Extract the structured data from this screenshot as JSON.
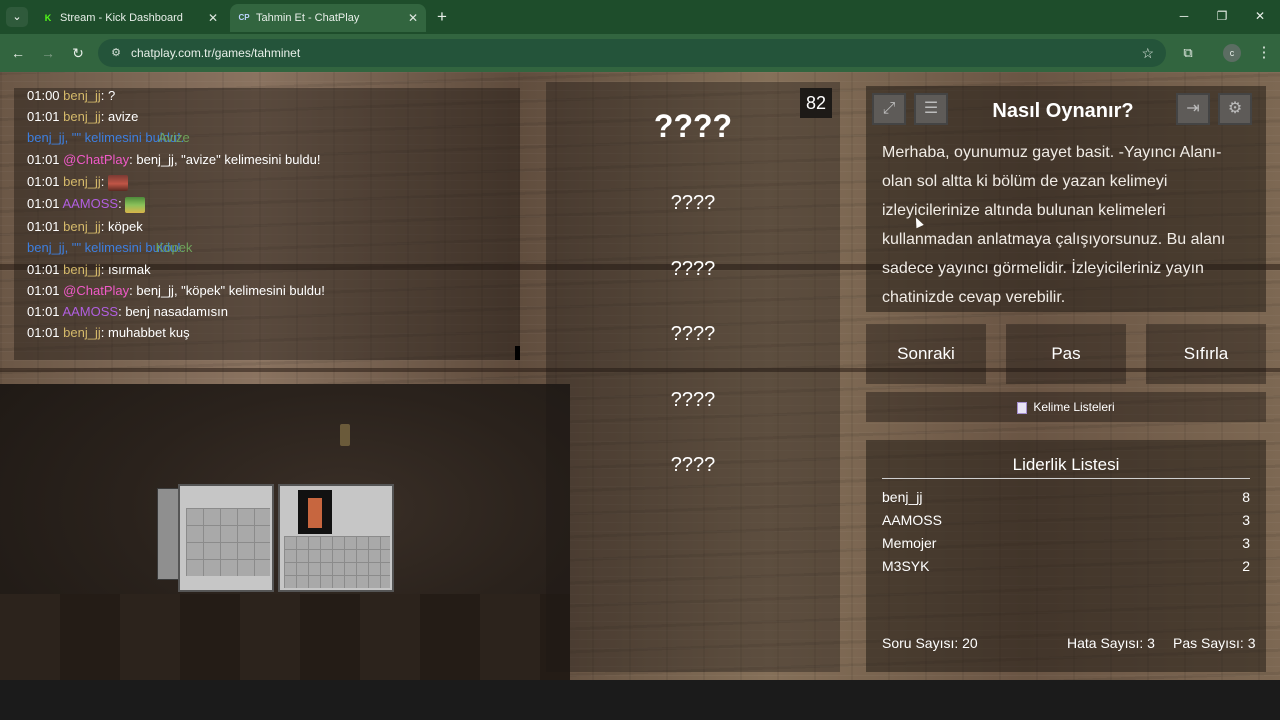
{
  "browser": {
    "tabs": [
      {
        "title": "Stream - Kick Dashboard",
        "favicon": "kick-favicon",
        "active": false
      },
      {
        "title": "Tahmin Et - ChatPlay",
        "favicon": "chatplay-favicon",
        "active": true
      }
    ],
    "url": "chatplay.com.tr/games/tahminet"
  },
  "chat": [
    {
      "time": "01:00",
      "user": "benj_jj",
      "text": "?"
    },
    {
      "time": "01:01",
      "user": "benj_jj",
      "text": "avize"
    },
    {
      "pre": "benj_jj, \"",
      "word": "Avize",
      "post": "\" kelimesini buldu!."
    },
    {
      "time": "01:01",
      "user": "@ChatPlay",
      "text": "benj_jj, \"avize\" kelimesini buldu!"
    },
    {
      "time": "01:01",
      "user": "benj_jj",
      "text": ""
    },
    {
      "time": "01:01",
      "user": "AAMOSS",
      "text": ""
    },
    {
      "time": "01:01",
      "user": "benj_jj",
      "text": "köpek"
    },
    {
      "pre": "benj_jj, \"",
      "word": "Köpek",
      "post": "\" kelimesini buldu!."
    },
    {
      "time": "01:01",
      "user": "benj_jj",
      "text": "ısırmak"
    },
    {
      "time": "01:01",
      "user": "@ChatPlay",
      "text": "benj_jj, \"köpek\" kelimesini buldu!"
    },
    {
      "time": "01:01",
      "user": "AAMOSS",
      "text": "benj nasadamısın"
    },
    {
      "time": "01:01",
      "user": "benj_jj",
      "text": "muhabbet kuş"
    }
  ],
  "game": {
    "counter": "82",
    "main_word": "????",
    "words": [
      "????",
      "????",
      "????",
      "????",
      "????"
    ]
  },
  "info": {
    "title": "Nasıl Oynanır?",
    "text": "Merhaba, oyunumuz gayet basit. -Yayıncı Alanı- olan sol altta ki bölüm de yazan kelimeyi izleyicilerinize altında bulunan kelimeleri kullanmadan anlatmaya çalışıyorsunuz. Bu alanı sadece yayıncı görmelidir. İzleyicileriniz yayın chatinizde cevap verebilir."
  },
  "controls": {
    "next": "Sonraki",
    "pass": "Pas",
    "reset": "Sıfırla",
    "word_lists": "Kelime Listeleri"
  },
  "leaderboard": {
    "title": "Liderlik Listesi",
    "rows": [
      {
        "name": "benj_jj",
        "points": "8"
      },
      {
        "name": "AAMOSS",
        "points": "3"
      },
      {
        "name": "Memojer",
        "points": "3"
      },
      {
        "name": "M3SYK",
        "points": "2"
      }
    ],
    "question_count": "Soru Sayısı: 20",
    "error_count": "Hata Sayısı: 3",
    "pass_count": "Pas Sayısı: 3"
  },
  "colors": {
    "tab_bar": "#1e4d2b",
    "toolbar": "#32653f",
    "nick_benj": "#d4b96a",
    "nick_chatplay": "#f05ac8",
    "nick_aamoss": "#b15fe0",
    "system_message": "#3d7fe0"
  }
}
